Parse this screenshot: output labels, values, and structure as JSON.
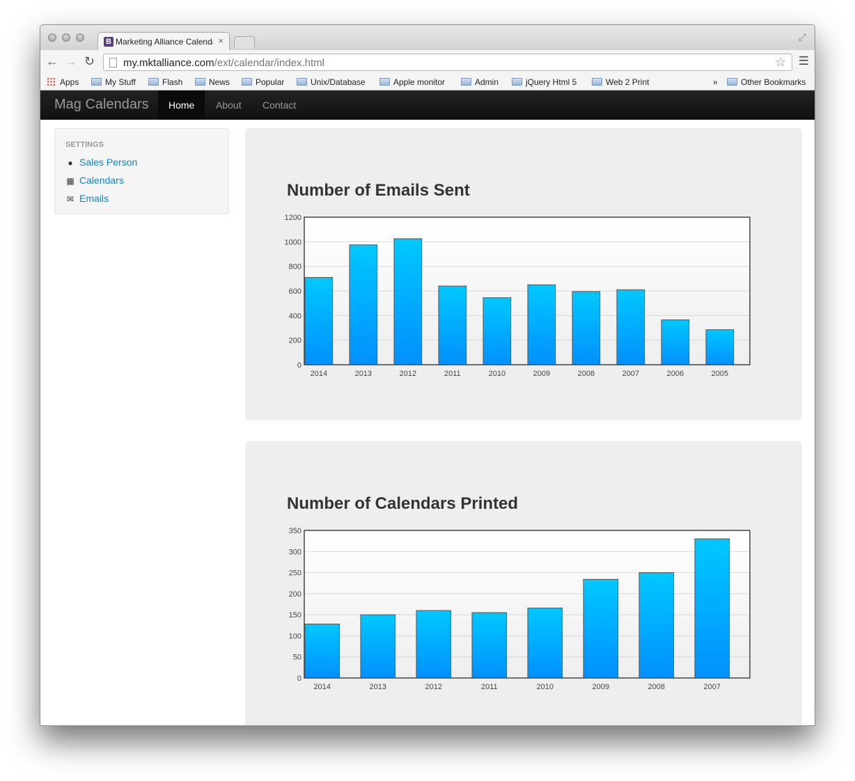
{
  "browser": {
    "tab_title": "Marketing Alliance Calendar",
    "tab_favicon": "B",
    "tab_close": "×",
    "url_host": "my.mktalliance.com",
    "url_path": "/ext/calendar/index.html",
    "bookmarks": [
      "Apps",
      "My Stuff",
      "Flash",
      "News",
      "Popular",
      "Unix/Database",
      "Apple monitor",
      "Admin",
      "jQuery Html 5",
      "Web 2 Print"
    ],
    "bookmarks_overflow": "»",
    "other_bookmarks": "Other Bookmarks"
  },
  "navbar": {
    "brand": "Mag Calendars",
    "items": [
      {
        "label": "Home",
        "active": true
      },
      {
        "label": "About",
        "active": false
      },
      {
        "label": "Contact",
        "active": false
      }
    ]
  },
  "sidebar": {
    "header": "Settings",
    "items": [
      {
        "label": "Sales Person",
        "icon": "user-icon"
      },
      {
        "label": "Calendars",
        "icon": "calendar-icon"
      },
      {
        "label": "Emails",
        "icon": "envelope-icon"
      }
    ]
  },
  "chart_data": [
    {
      "type": "bar",
      "title": "Number of Emails Sent",
      "categories": [
        "2014",
        "2013",
        "2012",
        "2011",
        "2010",
        "2009",
        "2008",
        "2007",
        "2006",
        "2005"
      ],
      "values": [
        710,
        975,
        1025,
        640,
        545,
        650,
        595,
        610,
        365,
        285
      ],
      "ylim": [
        0,
        1200
      ],
      "yticks": [
        0,
        200,
        400,
        600,
        800,
        1000,
        1200
      ],
      "grid": true,
      "colors": {
        "bar_top": "#00c8ff",
        "bar_bottom": "#0090ff",
        "bar_border": "#555555"
      }
    },
    {
      "type": "bar",
      "title": "Number of Calendars Printed",
      "categories": [
        "2014",
        "2013",
        "2012",
        "2011",
        "2010",
        "2009",
        "2008",
        "2007"
      ],
      "values": [
        128,
        150,
        160,
        155,
        166,
        234,
        250,
        330
      ],
      "ylim": [
        0,
        350
      ],
      "yticks": [
        0,
        50,
        100,
        150,
        200,
        250,
        300,
        350
      ],
      "grid": true,
      "colors": {
        "bar_top": "#00c8ff",
        "bar_bottom": "#0090ff",
        "bar_border": "#555555"
      }
    }
  ]
}
